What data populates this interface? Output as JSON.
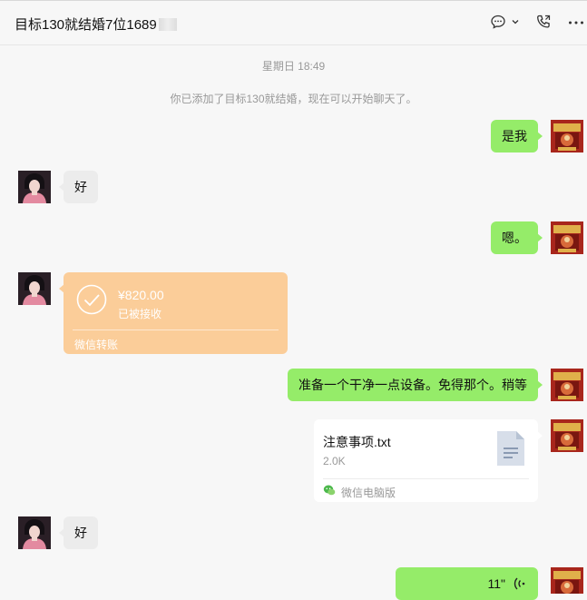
{
  "header": {
    "title": "目标130就结婚7位1689",
    "icons": [
      "chat-bubble-icon",
      "chevron-down-icon",
      "phone-icon",
      "more-icon"
    ]
  },
  "chat": {
    "timestamp": "星期日 18:49",
    "system_message": "你已添加了目标130就结婚，现在可以开始聊天了。",
    "messages": [
      {
        "from": "me",
        "type": "text",
        "text": "是我"
      },
      {
        "from": "other",
        "type": "text",
        "text": "好"
      },
      {
        "from": "me",
        "type": "text",
        "text": "嗯。"
      },
      {
        "from": "other",
        "type": "transfer",
        "amount": "¥820.00",
        "status": "已被接收",
        "footer": "微信转账"
      },
      {
        "from": "me",
        "type": "text",
        "text": "准备一个干净一点设备。免得那个。稍等"
      },
      {
        "from": "me",
        "type": "file",
        "name": "注意事项.txt",
        "size": "2.0K",
        "source": "微信电脑版"
      },
      {
        "from": "other",
        "type": "text",
        "text": "好"
      },
      {
        "from": "me",
        "type": "voice",
        "duration": "11\""
      }
    ]
  },
  "colors": {
    "my_bubble": "#95ec69",
    "other_bubble": "#ececec",
    "transfer": "#fbcd99",
    "background": "#f7f7f7"
  }
}
